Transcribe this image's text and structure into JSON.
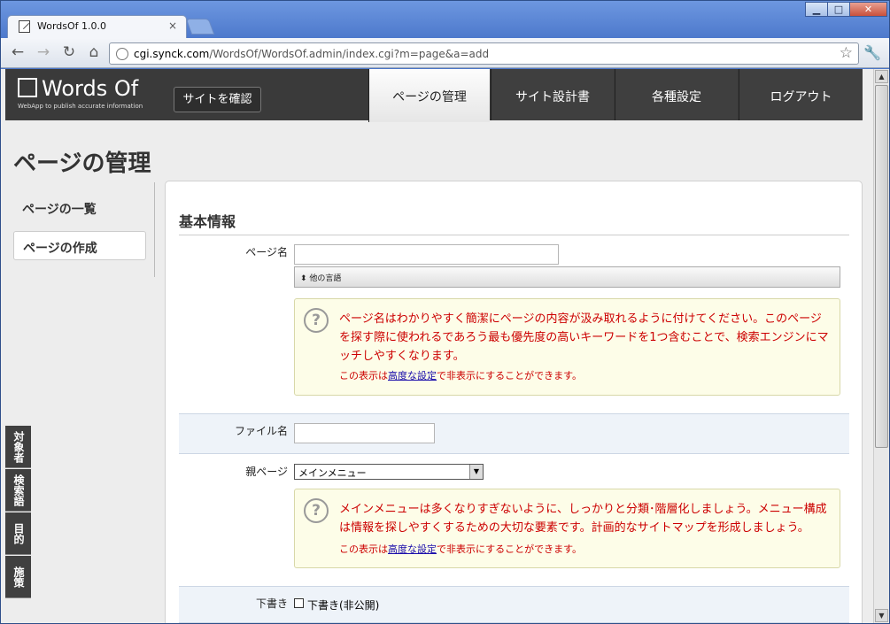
{
  "browser": {
    "tab_title": "WordsOf 1.0.0",
    "tab_close": "×",
    "url_host": "cgi.synck.com",
    "url_path": "/WordsOf/WordsOf.admin/index.cgi?m=page&a=add",
    "window_buttons": [
      "▁",
      "□",
      "✕"
    ]
  },
  "app": {
    "logo_name": "Words Of",
    "logo_tagline": "WebApp to publish accurate information",
    "site_button": "サイトを確認",
    "menu": [
      "ページの管理",
      "サイト設計書",
      "各種設定",
      "ログアウト"
    ],
    "active_menu": 0
  },
  "page": {
    "title": "ページの管理",
    "sidenav": [
      "ページの一覧",
      "ページの作成"
    ],
    "section_title": "基本情報"
  },
  "form": {
    "page_name_label": "ページ名",
    "page_name_value": "",
    "other_lang": "⬍ 他の言語",
    "help1_text": "ページ名はわかりやすく簡潔にページの内容が汲み取れるように付けてください。このページを探す際に使われるであろう最も優先度の高いキーワードを1つ含むことで、検索エンジンにマッチしやすくなります。",
    "help_note_pre": "この表示は",
    "help_note_link": "高度な設定",
    "help_note_post": "で非表示にすることができます。",
    "file_name_label": "ファイル名",
    "file_name_value": "",
    "parent_label": "親ページ",
    "parent_value": "メインメニュー",
    "help2_text": "メインメニューは多くなりすぎないように、しっかりと分類･階層化しましょう。メニュー構成は情報を探しやすくするための大切な要素です。計画的なサイトマップを形成しましょう。",
    "draft_label": "下書き",
    "draft_checkbox_label": "下書き(非公開)"
  },
  "side_tabs": [
    "対象者",
    "検索語",
    "目的",
    "施策"
  ]
}
